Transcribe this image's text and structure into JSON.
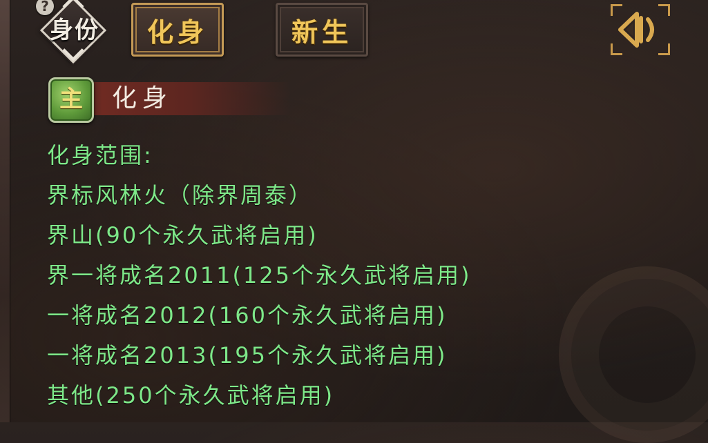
{
  "identity_toggle": {
    "help": "?",
    "label": "身份"
  },
  "tabs": [
    {
      "label": "化身",
      "active": true
    },
    {
      "label": "新生",
      "active": false
    }
  ],
  "section": {
    "badge": "主",
    "title": "化身"
  },
  "scope": {
    "heading": "化身范围:",
    "items": [
      "界标风林火（除界周泰）",
      "界山(90个永久武将启用)",
      "界一将成名2011(125个永久武将启用)",
      "一将成名2012(160个永久武将启用)",
      "一将成名2013(195个永久武将启用)",
      "其他(250个永久武将启用)"
    ]
  },
  "colors": {
    "scope_text": "#7ee889",
    "tab_text": "#f0c65a",
    "header_bar": "#6e2a22",
    "badge": "#5e9a3a"
  },
  "icons": {
    "sound": "speaker-icon",
    "help": "help-icon"
  }
}
